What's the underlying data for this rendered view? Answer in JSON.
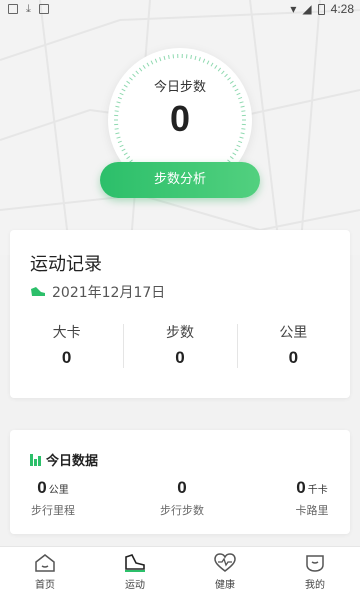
{
  "status_bar": {
    "time": "4:28"
  },
  "steps": {
    "label": "今日步数",
    "value": "0"
  },
  "analysis_button": {
    "label": "步数分析"
  },
  "record": {
    "title": "运动记录",
    "date": "2021年12月17日",
    "stats": [
      {
        "label": "大卡",
        "value": "0"
      },
      {
        "label": "步数",
        "value": "0"
      },
      {
        "label": "公里",
        "value": "0"
      }
    ]
  },
  "today": {
    "title": "今日数据",
    "items": [
      {
        "value": "0",
        "unit": "公里",
        "label": "步行里程"
      },
      {
        "value": "0",
        "unit": "",
        "label": "步行步数"
      },
      {
        "value": "0",
        "unit": "千卡",
        "label": "卡路里"
      }
    ]
  },
  "nav": [
    {
      "label": "首页",
      "icon": "home-icon"
    },
    {
      "label": "运动",
      "icon": "shoe-icon"
    },
    {
      "label": "健康",
      "icon": "heart-icon"
    },
    {
      "label": "我的",
      "icon": "profile-icon"
    }
  ],
  "colors": {
    "accent": "#2cbf6a"
  }
}
